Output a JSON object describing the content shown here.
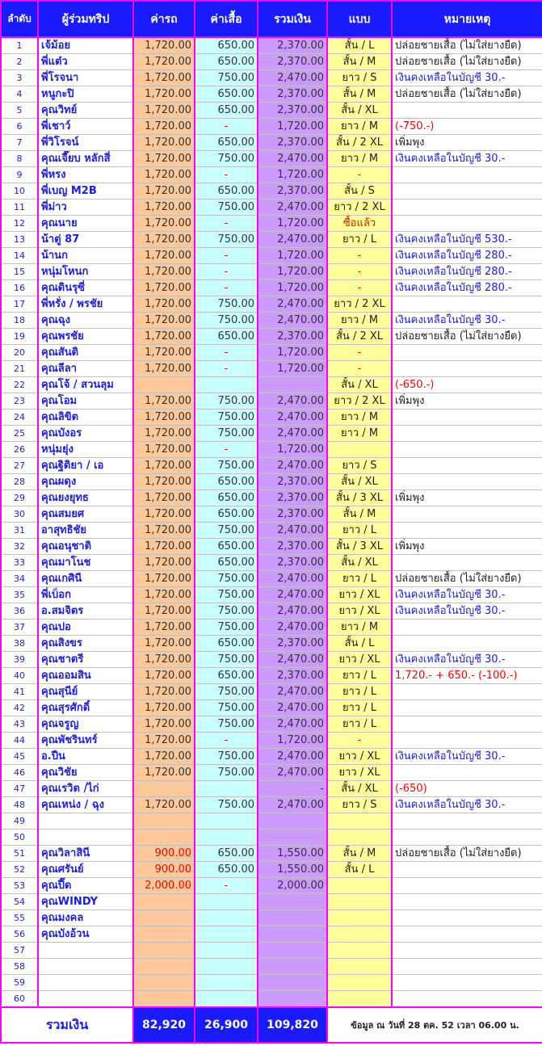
{
  "headers": {
    "no": "ลำดับ",
    "name": "ผู้ร่วมทริป",
    "fare": "ค่ารถ",
    "shirt": "ค่าเสื้อ",
    "total": "รวมเงิน",
    "style": "แบบ",
    "note": "หมายเหตุ"
  },
  "rows": [
    {
      "no": "1",
      "name": "เจ้ม้อย",
      "fare": "1,720.00",
      "shirt": "650.00",
      "total": "2,370.00",
      "style": "สั้น / L",
      "note": "ปล่อยชายเสื้อ (ไม่ใส่ยางยืด)",
      "note_color": "black"
    },
    {
      "no": "2",
      "name": "พี่แต๋ว",
      "fare": "1,720.00",
      "shirt": "650.00",
      "total": "2,370.00",
      "style": "สั้น / M",
      "note": "ปล่อยชายเสื้อ (ไม่ใส่ยางยืด)",
      "note_color": "black"
    },
    {
      "no": "3",
      "name": "พี่โรจนา",
      "fare": "1,720.00",
      "shirt": "750.00",
      "total": "2,470.00",
      "style": "ยาว / S",
      "note": "เงินคงเหลือในบัญชี  30.-",
      "note_color": "blue"
    },
    {
      "no": "4",
      "name": "หนูกะปิ",
      "fare": "1,720.00",
      "shirt": "650.00",
      "total": "2,370.00",
      "style": "สั้น / M",
      "note": "ปล่อยชายเสื้อ (ไม่ใส่ยางยืด)",
      "note_color": "black"
    },
    {
      "no": "5",
      "name": "คุณวิทย์",
      "fare": "1,720.00",
      "shirt": "650.00",
      "total": "2,370.00",
      "style": "สั้น / XL",
      "note": "",
      "note_color": "black"
    },
    {
      "no": "6",
      "name": "พี่เชาว์",
      "fare": "1,720.00",
      "shirt": "-",
      "total": "1,720.00",
      "style": "ยาว / M",
      "note": "(-750.-)",
      "note_color": "red"
    },
    {
      "no": "7",
      "name": "พี่วิโรจน์",
      "fare": "1,720.00",
      "shirt": "650.00",
      "total": "2,370.00",
      "style": "สั้น / 2 XL",
      "note": "เพิ่มพุง",
      "note_color": "black"
    },
    {
      "no": "8",
      "name": "คุณเจี๊ยบ หลักสี่",
      "fare": "1,720.00",
      "shirt": "750.00",
      "total": "2,470.00",
      "style": "ยาว / M",
      "note": "เงินคงเหลือในบัญชี  30.-",
      "note_color": "blue"
    },
    {
      "no": "9",
      "name": "พี่หรง",
      "fare": "1,720.00",
      "shirt": "-",
      "total": "1,720.00",
      "style": "-",
      "note": "",
      "note_color": "black"
    },
    {
      "no": "10",
      "name": "พี่เบญ M2B",
      "fare": "1,720.00",
      "shirt": "650.00",
      "total": "2,370.00",
      "style": "สั้น / S",
      "note": "",
      "note_color": "black"
    },
    {
      "no": "11",
      "name": "พี่ม่าว",
      "fare": "1,720.00",
      "shirt": "750.00",
      "total": "2,470.00",
      "style": "ยาว  / 2 XL",
      "note": "",
      "note_color": "black"
    },
    {
      "no": "12",
      "name": "คุณนาย",
      "fare": "1,720.00",
      "shirt": "-",
      "total": "1,720.00",
      "style": "ซื้อแล้ว",
      "note": "",
      "note_color": "black"
    },
    {
      "no": "13",
      "name": "น้าตู่ 87",
      "fare": "1,720.00",
      "shirt": "750.00",
      "total": "2,470.00",
      "style": "ยาว / L",
      "note": "เงินคงเหลือในบัญชี  530.-",
      "note_color": "blue"
    },
    {
      "no": "14",
      "name": "น้านก",
      "fare": "1,720.00",
      "shirt": "-",
      "total": "1,720.00",
      "style": "-",
      "note": "เงินคงเหลือในบัญชี  280.-",
      "note_color": "blue"
    },
    {
      "no": "15",
      "name": "หนุ่มโหนก",
      "fare": "1,720.00",
      "shirt": "-",
      "total": "1,720.00",
      "style": "-",
      "note": "เงินคงเหลือในบัญชี  280.-",
      "note_color": "blue"
    },
    {
      "no": "16",
      "name": "คุณดินรุซี่",
      "fare": "1,720.00",
      "shirt": "-",
      "total": "1,720.00",
      "style": "-",
      "note": "เงินคงเหลือในบัญชี  280.-",
      "note_color": "blue"
    },
    {
      "no": "17",
      "name": "พี่หรั่ง / พรชัย",
      "fare": "1,720.00",
      "shirt": "750.00",
      "total": "2,470.00",
      "style": "ยาว  / 2 XL",
      "note": "",
      "note_color": "black"
    },
    {
      "no": "18",
      "name": "คุณฉุง",
      "fare": "1,720.00",
      "shirt": "750.00",
      "total": "2,470.00",
      "style": "ยาว / M",
      "note": "เงินคงเหลือในบัญชี  30.-",
      "note_color": "blue"
    },
    {
      "no": "19",
      "name": "คุณพรชัย",
      "fare": "1,720.00",
      "shirt": "650.00",
      "total": "2,370.00",
      "style": "สั้น / 2 XL",
      "note": "ปล่อยชายเสื้อ (ไม่ใส่ยางยืด)",
      "note_color": "black"
    },
    {
      "no": "20",
      "name": "คุณสันติ",
      "fare": "1,720.00",
      "shirt": "-",
      "total": "1,720.00",
      "style": "-",
      "note": "",
      "note_color": "black"
    },
    {
      "no": "21",
      "name": "คุณลีลา",
      "fare": "1,720.00",
      "shirt": "-",
      "total": "1,720.00",
      "style": "-",
      "note": "",
      "note_color": "black"
    },
    {
      "no": "22",
      "name": "คุณโจ้ / สวนลุม",
      "fare": "",
      "shirt": "",
      "total": "",
      "style": "สั้น / XL",
      "note": "(-650.-)",
      "note_color": "red"
    },
    {
      "no": "23",
      "name": "คุณโอม",
      "fare": "1,720.00",
      "shirt": "750.00",
      "total": "2,470.00",
      "style": "ยาว  / 2 XL",
      "note": "เพิ่มพุง",
      "note_color": "black"
    },
    {
      "no": "24",
      "name": "คุณลิขิต",
      "fare": "1,720.00",
      "shirt": "750.00",
      "total": "2,470.00",
      "style": "ยาว / M",
      "note": "",
      "note_color": "black"
    },
    {
      "no": "25",
      "name": "คุณบังอร",
      "fare": "1,720.00",
      "shirt": "750.00",
      "total": "2,470.00",
      "style": "ยาว / M",
      "note": "",
      "note_color": "black"
    },
    {
      "no": "26",
      "name": "หนุ่มยุ่ง",
      "fare": "1,720.00",
      "shirt": "-",
      "total": "1,720.00",
      "style": "",
      "note": "",
      "note_color": "black"
    },
    {
      "no": "27",
      "name": "คุณฐิติยา / เอ",
      "fare": "1,720.00",
      "shirt": "750.00",
      "total": "2,470.00",
      "style": "ยาว / S",
      "note": "",
      "note_color": "black"
    },
    {
      "no": "28",
      "name": "คุณผดุง",
      "fare": "1,720.00",
      "shirt": "650.00",
      "total": "2,370.00",
      "style": "สั้น / XL",
      "note": "",
      "note_color": "black"
    },
    {
      "no": "29",
      "name": "คุณยงยุทธ",
      "fare": "1,720.00",
      "shirt": "650.00",
      "total": "2,370.00",
      "style": "สั้น / 3 XL",
      "note": "เพิ่มพุง",
      "note_color": "black"
    },
    {
      "no": "30",
      "name": "คุณสมยศ",
      "fare": "1,720.00",
      "shirt": "650.00",
      "total": "2,370.00",
      "style": "สั้น / M",
      "note": "",
      "note_color": "black"
    },
    {
      "no": "31",
      "name": "อาสุทธิชัย",
      "fare": "1,720.00",
      "shirt": "750.00",
      "total": "2,470.00",
      "style": "ยาว / L",
      "note": "",
      "note_color": "black"
    },
    {
      "no": "32",
      "name": "คุณอนุชาติ",
      "fare": "1,720.00",
      "shirt": "650.00",
      "total": "2,370.00",
      "style": "สั้น / 3 XL",
      "note": "เพิ่มพุง",
      "note_color": "black"
    },
    {
      "no": "33",
      "name": "คุณมาโนช",
      "fare": "1,720.00",
      "shirt": "650.00",
      "total": "2,370.00",
      "style": "สั้น / XL",
      "note": "",
      "note_color": "black"
    },
    {
      "no": "34",
      "name": "คุณเกศินี",
      "fare": "1,720.00",
      "shirt": "750.00",
      "total": "2,470.00",
      "style": "ยาว / L",
      "note": "ปล่อยชายเสื้อ (ไม่ใส่ยางยืด)",
      "note_color": "black"
    },
    {
      "no": "35",
      "name": "พี่เบ็อก",
      "fare": "1,720.00",
      "shirt": "750.00",
      "total": "2,470.00",
      "style": "ยาว / XL",
      "note": "เงินคงเหลือในบัญชี  30.-",
      "note_color": "blue"
    },
    {
      "no": "36",
      "name": "อ.สมจิตร",
      "fare": "1,720.00",
      "shirt": "750.00",
      "total": "2,470.00",
      "style": "ยาว / XL",
      "note": "เงินคงเหลือในบัญชี  30.-",
      "note_color": "blue"
    },
    {
      "no": "37",
      "name": "คุณปอ",
      "fare": "1,720.00",
      "shirt": "750.00",
      "total": "2,470.00",
      "style": "ยาว / M",
      "note": "",
      "note_color": "black"
    },
    {
      "no": "38",
      "name": "คุณสิงขร",
      "fare": "1,720.00",
      "shirt": "650.00",
      "total": "2,370.00",
      "style": "สั้น / L",
      "note": "",
      "note_color": "black"
    },
    {
      "no": "39",
      "name": "คุณชาตรี",
      "fare": "1,720.00",
      "shirt": "750.00",
      "total": "2,470.00",
      "style": "ยาว / XL",
      "note": "เงินคงเหลือในบัญชี  30.-",
      "note_color": "blue"
    },
    {
      "no": "40",
      "name": "คุณออมสิน",
      "fare": "1,720.00",
      "shirt": "650.00",
      "total": "2,370.00",
      "style": "ยาว / L",
      "note": "1,720.- + 650.- (-100.-)",
      "note_color": "red"
    },
    {
      "no": "41",
      "name": "คุณสุนีย์",
      "fare": "1,720.00",
      "shirt": "750.00",
      "total": "2,470.00",
      "style": "ยาว / L",
      "note": "",
      "note_color": "black"
    },
    {
      "no": "42",
      "name": "คุณสุรศักดิ์",
      "fare": "1,720.00",
      "shirt": "750.00",
      "total": "2,470.00",
      "style": "ยาว / L",
      "note": "",
      "note_color": "black"
    },
    {
      "no": "43",
      "name": "คุณจรูญ",
      "fare": "1,720.00",
      "shirt": "750.00",
      "total": "2,470.00",
      "style": "ยาว / L",
      "note": "",
      "note_color": "black"
    },
    {
      "no": "44",
      "name": "คุณพัชรินทร์",
      "fare": "1,720.00",
      "shirt": "-",
      "total": "1,720.00",
      "style": "-",
      "note": "",
      "note_color": "black"
    },
    {
      "no": "45",
      "name": "อ.ปืน",
      "fare": "1,720.00",
      "shirt": "750.00",
      "total": "2,470.00",
      "style": "ยาว / XL",
      "note": "เงินคงเหลือในบัญชี  30.-",
      "note_color": "blue"
    },
    {
      "no": "46",
      "name": "คุณวิชัย",
      "fare": "1,720.00",
      "shirt": "750.00",
      "total": "2,470.00",
      "style": "ยาว / XL",
      "note": "",
      "note_color": "black"
    },
    {
      "no": "47",
      "name": "คุณเรวิต /ไก่",
      "fare": "",
      "shirt": "",
      "total": "-",
      "style": "สั้น / XL",
      "note": "(-650)",
      "note_color": "red"
    },
    {
      "no": "48",
      "name": "คุณเหน่ง / ฉุง",
      "fare": "1,720.00",
      "shirt": "750.00",
      "total": "2,470.00",
      "style": "ยาว / S",
      "note": "เงินคงเหลือในบัญชี  30.-",
      "note_color": "blue"
    },
    {
      "no": "49",
      "name": "",
      "fare": "",
      "shirt": "",
      "total": "",
      "style": "",
      "note": "",
      "note_color": "black"
    },
    {
      "no": "50",
      "name": "",
      "fare": "",
      "shirt": "",
      "total": "",
      "style": "",
      "note": "",
      "note_color": "black"
    },
    {
      "no": "51",
      "name": "คุณวิลาสินี",
      "fare": "900.00",
      "shirt": "650.00",
      "total": "1,550.00",
      "style": "สั้น / M",
      "note": "ปล่อยชายเสื้อ (ไม่ใส่ยางยืด)",
      "note_color": "black",
      "fare_red": true
    },
    {
      "no": "52",
      "name": "คุณศรันย์",
      "fare": "900.00",
      "shirt": "650.00",
      "total": "1,550.00",
      "style": "สั้น / L",
      "note": "",
      "note_color": "black",
      "fare_red": true
    },
    {
      "no": "53",
      "name": "คุณปี๊ด",
      "fare": "2,000.00",
      "shirt": "-",
      "total": "2,000.00",
      "style": "",
      "note": "",
      "note_color": "black",
      "fare_red": true
    },
    {
      "no": "54",
      "name": "คุณWINDY",
      "fare": "",
      "shirt": "",
      "total": "",
      "style": "",
      "note": "",
      "note_color": "black"
    },
    {
      "no": "55",
      "name": "คุณมงคล",
      "fare": "",
      "shirt": "",
      "total": "",
      "style": "",
      "note": "",
      "note_color": "black"
    },
    {
      "no": "56",
      "name": "คุณบังอ้วน",
      "fare": "",
      "shirt": "",
      "total": "",
      "style": "",
      "note": "",
      "note_color": "black"
    },
    {
      "no": "57",
      "name": "",
      "fare": "",
      "shirt": "",
      "total": "",
      "style": "",
      "note": "",
      "note_color": "black"
    },
    {
      "no": "58",
      "name": "",
      "fare": "",
      "shirt": "",
      "total": "",
      "style": "",
      "note": "",
      "note_color": "black"
    },
    {
      "no": "59",
      "name": "",
      "fare": "",
      "shirt": "",
      "total": "",
      "style": "",
      "note": "",
      "note_color": "black"
    },
    {
      "no": "60",
      "name": "",
      "fare": "",
      "shirt": "",
      "total": "",
      "style": "",
      "note": "",
      "note_color": "black"
    }
  ],
  "footer": {
    "label": "รวมเงิน",
    "fare_total": "82,920",
    "shirt_total": "26,900",
    "grand_total": "109,820",
    "info": "ข้อมูล ณ วันที่  28  ตค. 52 เวลา 06.00 น."
  },
  "colors": {
    "header_bg": "#1a1aff",
    "grid_line": "#ff00ff",
    "fare_col": "#fcc89a",
    "shirt_col": "#c8ffff",
    "total_col": "#cc99ff",
    "style_col": "#ffff99",
    "name_text": "#1a1aff",
    "red_text": "#ff0000"
  }
}
